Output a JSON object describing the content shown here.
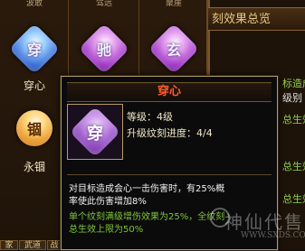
{
  "top_tabs": [
    "波敢",
    "驾远",
    "聚崖"
  ],
  "right_panel": {
    "title": "刻效果总览",
    "lines": [
      "标造成",
      "总生效",
      "总生效",
      "总生效"
    ],
    "lines_white": [
      "级别",
      "",
      ""
    ]
  },
  "skills": [
    {
      "glyph": "穿",
      "label": "穿心",
      "color": "blue"
    },
    {
      "glyph": "驰",
      "label": "",
      "color": "purple"
    },
    {
      "glyph": "玄",
      "label": "",
      "color": "purple"
    },
    {
      "glyph": "锢",
      "label": "永锢",
      "color": "gold"
    }
  ],
  "tooltip": {
    "title": "穿心",
    "icon_glyph": "穿",
    "level_label": "等级：4级",
    "progress_label": "升级纹刻进度：4/4",
    "description_1": "对目标造成会心一击伤害时，有25%概",
    "description_2": "率使此伤害增加8%",
    "green_1": "单个纹刻满级增伤效果为25%，全纹刻",
    "green_2": "总生效上限为50%"
  },
  "bottom_tabs": [
    "家",
    "武道",
    "战"
  ],
  "watermark": {
    "text": "神仙代售",
    "url": "WWW.SXDS.COM"
  }
}
